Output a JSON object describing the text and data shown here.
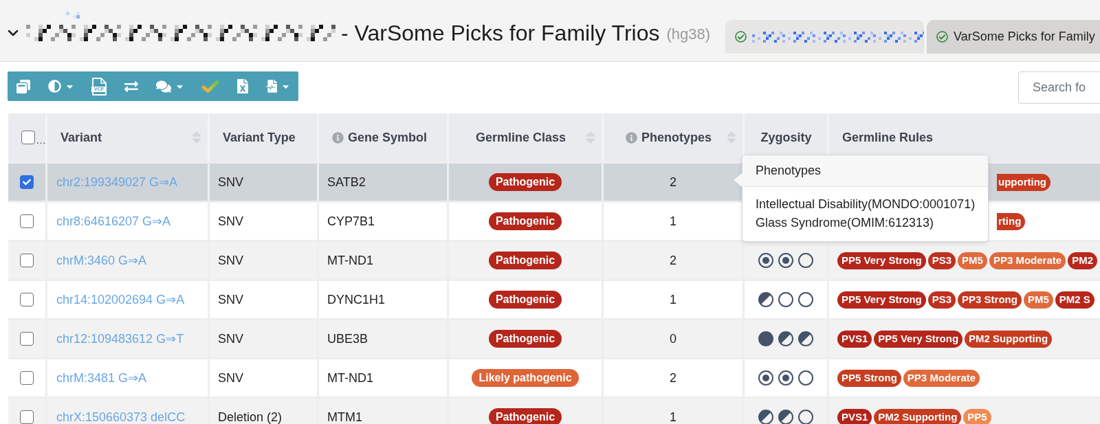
{
  "title": {
    "expanded": true,
    "text": "- VarSome Picks for Family Trios",
    "assembly": "(hg38)"
  },
  "tabs": [
    {
      "kind": "redacted",
      "selected": false
    },
    {
      "kind": "labeled",
      "label": "VarSome Picks for Family",
      "selected": true
    }
  ],
  "toolbar": [
    {
      "kind": "copy",
      "dropdown": false
    },
    {
      "kind": "contrast",
      "dropdown": true
    },
    {
      "kind": "vcf",
      "label": "VCF",
      "dropdown": false
    },
    {
      "kind": "swap",
      "dropdown": false
    },
    {
      "kind": "comments",
      "dropdown": true
    },
    {
      "kind": "check",
      "dropdown": false
    },
    {
      "kind": "excel",
      "dropdown": false
    },
    {
      "kind": "report",
      "dropdown": true
    }
  ],
  "search": {
    "placeholder": "Search fo"
  },
  "table": {
    "select_all": {
      "checked": false,
      "text": "…"
    },
    "columns": [
      {
        "label": "Variant",
        "sortable": true,
        "info": false
      },
      {
        "label": "Variant Type",
        "sortable": false,
        "info": false
      },
      {
        "label": "Gene Symbol",
        "sortable": false,
        "info": true
      },
      {
        "label": "Germline Class",
        "sortable": true,
        "info": false
      },
      {
        "label": "Phenotypes",
        "sortable": true,
        "info": true
      },
      {
        "label": "Zygosity",
        "sortable": false,
        "info": false
      },
      {
        "label": "Germline Rules",
        "sortable": false,
        "info": false
      }
    ],
    "rows": [
      {
        "selected": true,
        "checked": true,
        "variant": "chr2:199349027 G⇒A",
        "type": "SNV",
        "gene": "SATB2",
        "class": {
          "label": "Pathogenic",
          "color": "#b5261b"
        },
        "phenotypes": "2",
        "rules": [
          {
            "kind": "clipped",
            "label": "upporting",
            "color": "#c83b20"
          }
        ]
      },
      {
        "selected": false,
        "checked": false,
        "variant": "chr8:64616207 G⇒A",
        "type": "SNV",
        "gene": "CYP7B1",
        "class": {
          "label": "Pathogenic",
          "color": "#b5261b"
        },
        "phenotypes": "1",
        "rules": [
          {
            "kind": "clipped",
            "label": "rting",
            "color": "#c83b20"
          }
        ]
      },
      {
        "selected": false,
        "checked": false,
        "variant": "chrM:3460 G⇒A",
        "type": "SNV",
        "gene": "MT-ND1",
        "class": {
          "label": "Pathogenic",
          "color": "#b5261b"
        },
        "phenotypes": "2",
        "zygosity": [
          {
            "kind": "dot"
          },
          {
            "kind": "dot"
          },
          {
            "kind": "empty"
          }
        ],
        "rules": [
          {
            "kind": "whole",
            "label": "PP5 Very Strong",
            "color": "#b5261b"
          },
          {
            "kind": "whole",
            "label": "PS3",
            "color": "#c0301f"
          },
          {
            "kind": "whole",
            "label": "PM5",
            "color": "#e06a3c"
          },
          {
            "kind": "whole",
            "label": "PP3 Moderate",
            "color": "#e06a3c"
          },
          {
            "kind": "whole",
            "label": "PM2",
            "color": "#b9271b"
          }
        ]
      },
      {
        "selected": false,
        "checked": false,
        "variant": "chr14:102002694 G⇒A",
        "type": "SNV",
        "gene": "DYNC1H1",
        "class": {
          "label": "Pathogenic",
          "color": "#b5261b"
        },
        "phenotypes": "1",
        "zygosity": [
          {
            "kind": "half"
          },
          {
            "kind": "empty"
          },
          {
            "kind": "empty"
          }
        ],
        "rules": [
          {
            "kind": "whole",
            "label": "PP5 Very Strong",
            "color": "#b5261b"
          },
          {
            "kind": "whole",
            "label": "PS3",
            "color": "#c0301f"
          },
          {
            "kind": "whole",
            "label": "PP3 Strong",
            "color": "#c3371f"
          },
          {
            "kind": "whole",
            "label": "PM5",
            "color": "#e06a3c"
          },
          {
            "kind": "whole",
            "label": "PM2 S",
            "color": "#b9271b"
          }
        ]
      },
      {
        "selected": false,
        "checked": false,
        "variant": "chr12:109483612 G⇒T",
        "type": "SNV",
        "gene": "UBE3B",
        "class": {
          "label": "Pathogenic",
          "color": "#b5261b"
        },
        "phenotypes": "0",
        "zygosity": [
          {
            "kind": "full"
          },
          {
            "kind": "half"
          },
          {
            "kind": "half"
          }
        ],
        "rules": [
          {
            "kind": "whole",
            "label": "PVS1",
            "color": "#b3231a"
          },
          {
            "kind": "whole",
            "label": "PP5 Very Strong",
            "color": "#b5261b"
          },
          {
            "kind": "whole",
            "label": "PM2 Supporting",
            "color": "#c63c20"
          }
        ]
      },
      {
        "selected": false,
        "checked": false,
        "variant": "chrM:3481 G⇒A",
        "type": "SNV",
        "gene": "MT-ND1",
        "class": {
          "label": "Likely pathogenic",
          "color": "#df6437"
        },
        "phenotypes": "2",
        "zygosity": [
          {
            "kind": "dot"
          },
          {
            "kind": "dot"
          },
          {
            "kind": "empty"
          }
        ],
        "rules": [
          {
            "kind": "whole",
            "label": "PP5 Strong",
            "color": "#c73e21"
          },
          {
            "kind": "whole",
            "label": "PP3 Moderate",
            "color": "#e06a3c"
          }
        ]
      },
      {
        "selected": false,
        "checked": false,
        "variant": "chrX:150660373 delCC",
        "type": "Deletion (2)",
        "gene": "MTM1",
        "class": {
          "label": "Pathogenic",
          "color": "#b5261b"
        },
        "phenotypes": "1",
        "zygosity": [
          {
            "kind": "half"
          },
          {
            "kind": "half"
          },
          {
            "kind": "empty"
          }
        ],
        "rules": [
          {
            "kind": "whole",
            "label": "PVS1",
            "color": "#b3231a"
          },
          {
            "kind": "whole",
            "label": "PM2 Supporting",
            "color": "#c63c20"
          },
          {
            "kind": "whole",
            "label": "PP5",
            "color": "#ef8b50"
          }
        ]
      }
    ]
  },
  "phenotypes_popover": {
    "title": "Phenotypes",
    "lines": [
      "Intellectual Disability(MONDO:0001071)",
      "Glass Syndrome(OMIM:612313)"
    ]
  }
}
